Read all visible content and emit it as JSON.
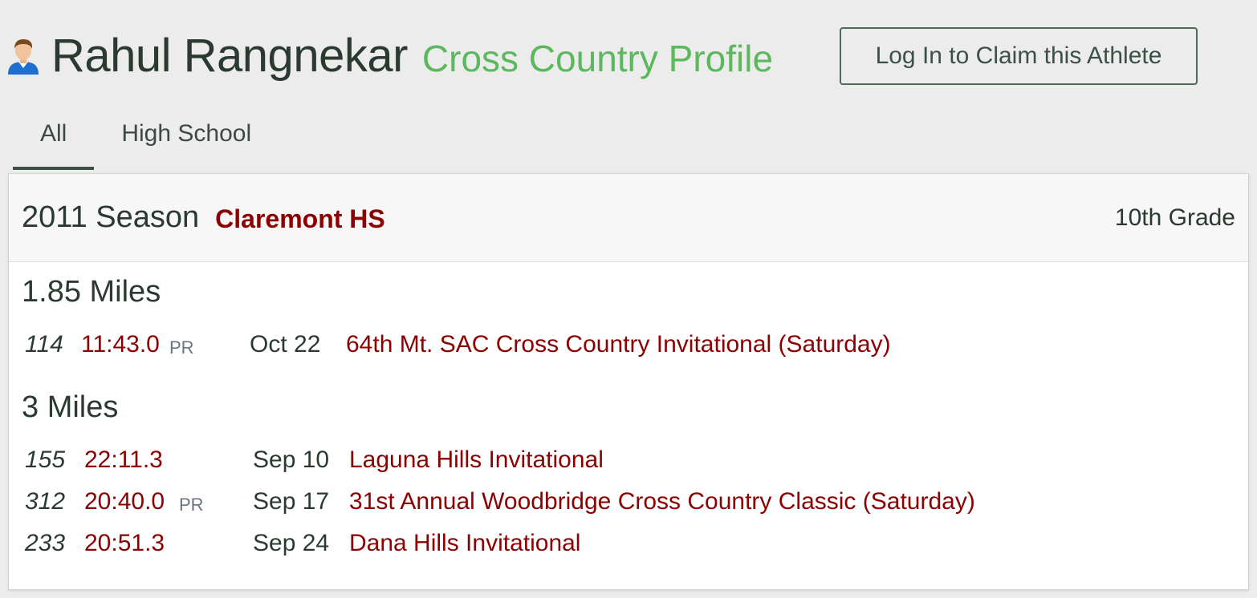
{
  "header": {
    "athlete_name": "Rahul Rangnekar",
    "subtitle": "Cross Country Profile",
    "claim_button": "Log In to Claim this Athlete",
    "avatar_icon": "person-icon"
  },
  "tabs": [
    {
      "label": "All",
      "active": true
    },
    {
      "label": "High School",
      "active": false
    }
  ],
  "season": {
    "title": "2011 Season",
    "school": "Claremont HS",
    "grade": "10th Grade",
    "accent_color": "#8b0000"
  },
  "distances": [
    {
      "label": "1.85 Miles",
      "results": [
        {
          "place": "114",
          "time": "11:43.0",
          "pr": "PR",
          "date": "Oct 22",
          "meet": "64th Mt. SAC Cross Country Invitational (Saturday)"
        }
      ]
    },
    {
      "label": "3 Miles",
      "results": [
        {
          "place": "155",
          "time": "22:11.3",
          "pr": "",
          "date": "Sep 10",
          "meet": "Laguna Hills Invitational"
        },
        {
          "place": "312",
          "time": "20:40.0",
          "pr": "PR",
          "date": "Sep 17",
          "meet": "31st Annual Woodbridge Cross Country Classic (Saturday)"
        },
        {
          "place": "233",
          "time": "20:51.3",
          "pr": "",
          "date": "Sep 24",
          "meet": "Dana Hills Invitational"
        }
      ]
    }
  ],
  "colors": {
    "subtitle_green": "#5cb85c",
    "link_red": "#8b0000",
    "text_dark": "#2b3a30"
  }
}
